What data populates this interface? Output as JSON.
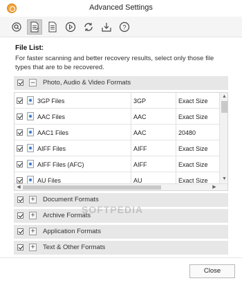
{
  "window": {
    "title": "Advanced Settings"
  },
  "toolbar": {
    "buttons": [
      {
        "icon": "search-icon",
        "active": false
      },
      {
        "icon": "file-list-icon",
        "active": true
      },
      {
        "icon": "document-icon",
        "active": false
      },
      {
        "icon": "play-icon",
        "active": false
      },
      {
        "icon": "refresh-icon",
        "active": false
      },
      {
        "icon": "download-icon",
        "active": false
      },
      {
        "icon": "help-icon",
        "active": false
      }
    ]
  },
  "main": {
    "heading": "File List:",
    "description": "For faster scanning and better recovery results, select only those file types that are to be recovered."
  },
  "sections": {
    "media": {
      "label": "Photo, Audio & Video Formats",
      "expander": "–",
      "checked": true
    },
    "document": {
      "label": "Document Formats",
      "expander": "+",
      "checked": true
    },
    "archive": {
      "label": "Archive Formats",
      "expander": "+",
      "checked": true
    },
    "application": {
      "label": "Application Formats",
      "expander": "+",
      "checked": true
    },
    "text": {
      "label": "Text & Other Formats",
      "expander": "+",
      "checked": true
    }
  },
  "files": [
    {
      "name": "3GP Files",
      "ext": "3GP",
      "size": "Exact Size",
      "checked": true
    },
    {
      "name": "AAC Files",
      "ext": "AAC",
      "size": "Exact Size",
      "checked": true
    },
    {
      "name": "AAC1 Files",
      "ext": "AAC",
      "size": "20480",
      "checked": true
    },
    {
      "name": "AIFF Files",
      "ext": "AIFF",
      "size": "Exact Size",
      "checked": true
    },
    {
      "name": "AIFF Files (AFC)",
      "ext": "AIFF",
      "size": "Exact Size",
      "checked": true
    },
    {
      "name": "AU Files",
      "ext": "AU",
      "size": "Exact Size",
      "checked": true
    }
  ],
  "watermark": "SOFTPEDIA",
  "footer": {
    "close_label": "Close"
  },
  "colors": {
    "accent_orange": "#f3a23b",
    "section_bg": "#e7e7e7",
    "active_tool_bg": "#cfcfcf"
  }
}
